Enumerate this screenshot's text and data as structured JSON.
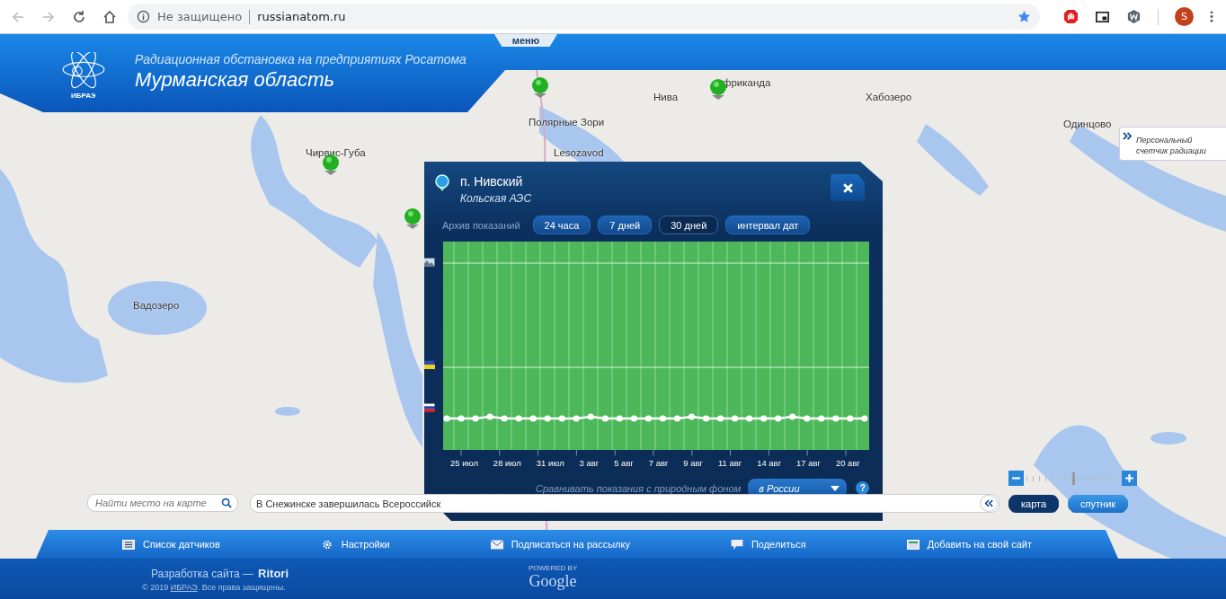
{
  "browser": {
    "security": "Не защищено",
    "url": "russianatom.ru",
    "profile_initial": "S"
  },
  "header": {
    "menu_tab": "меню",
    "logo_text": "ИБРАЭ",
    "subtitle": "Радиационная обстановка на предприятиях Росатома",
    "title": "Мурманская область"
  },
  "map_labels": [
    "фриканда",
    "Нива",
    "Хабозеро",
    "Полярные Зори",
    "Одинцово",
    "Чирвис-Губа",
    "Lesozavod",
    "Вадозеро"
  ],
  "personal_counter": {
    "label": "Персональный счетчик радиации"
  },
  "popup": {
    "place": "п. Нивский",
    "facility": "Кольская АЭС",
    "archive_label": "Архив показаний",
    "ranges": [
      {
        "label": "24 часа",
        "selected": false
      },
      {
        "label": "7 дней",
        "selected": false
      },
      {
        "label": "30 дней",
        "selected": true
      },
      {
        "label": "интервал дат",
        "selected": false
      }
    ],
    "x_labels": [
      "25 июл",
      "28 июл",
      "31 июл",
      "3 авг",
      "5 авг",
      "7 авг",
      "9 авг",
      "11 авг",
      "14 авг",
      "17 авг",
      "20 авг"
    ],
    "compare_label": "Сравнивать показания с природным фоном",
    "compare_value": "в России",
    "help": "?"
  },
  "search": {
    "placeholder": "Найти место на карте"
  },
  "news": "В Снежинске завершилась Всероссийск",
  "zoom": {
    "level": 0.5
  },
  "map_types": [
    {
      "label": "карта",
      "selected": true
    },
    {
      "label": "спутник",
      "selected": false
    }
  ],
  "footer_tabs": [
    {
      "label": "Список датчиков",
      "kind": "list"
    },
    {
      "label": "Настройки",
      "kind": "settings"
    },
    {
      "label": "Подписаться на рассылку",
      "kind": "mail"
    },
    {
      "label": "Поделиться",
      "kind": "share"
    },
    {
      "label": "Добавить на свой сайт",
      "kind": "widget"
    }
  ],
  "credits": {
    "dev_prefix": "Разработка сайта —",
    "dev_name": "Ritori",
    "copyright_before": "© 2019 ",
    "copyright_link": "ИБРАЭ",
    "copyright_after": ". Все права защищены.",
    "powered_by": "POWERED BY",
    "google": "Google"
  }
}
